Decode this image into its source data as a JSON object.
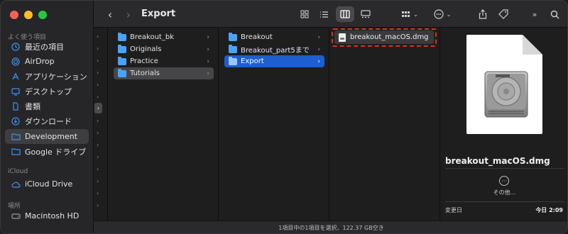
{
  "window": {
    "title": "Export"
  },
  "colors": {
    "close": "#fe5f57",
    "minimize": "#febc2e",
    "zoom": "#28c840",
    "accent": "#1b5fd1",
    "folder": "#4aa3f5",
    "highlight_box": "#d9321f"
  },
  "sidebar": {
    "favorites_title": "よく使う項目",
    "favorites": [
      {
        "label": "最近の項目",
        "icon": "clock-icon"
      },
      {
        "label": "AirDrop",
        "icon": "airdrop-icon"
      },
      {
        "label": "アプリケーション",
        "icon": "applications-icon"
      },
      {
        "label": "デスクトップ",
        "icon": "desktop-icon"
      },
      {
        "label": "書類",
        "icon": "document-icon"
      },
      {
        "label": "ダウンロード",
        "icon": "download-icon"
      },
      {
        "label": "Development",
        "icon": "folder-icon",
        "selected": true
      },
      {
        "label": "Google ドライブ",
        "icon": "folder-icon"
      }
    ],
    "icloud_title": "iCloud",
    "icloud": [
      {
        "label": "iCloud Drive",
        "icon": "cloud-icon"
      }
    ],
    "locations_title": "場所",
    "locations": [
      {
        "label": "Macintosh HD",
        "icon": "disk-icon"
      }
    ]
  },
  "columns": {
    "col1": [
      {
        "label": "Breakout_bk"
      },
      {
        "label": "Originals"
      },
      {
        "label": "Practice"
      },
      {
        "label": "Tutorials",
        "selected": true
      }
    ],
    "col2": [
      {
        "label": "Breakout"
      },
      {
        "label": "Breakout_part5まで"
      },
      {
        "label": "Export",
        "selected": true
      }
    ],
    "col3": [
      {
        "label": "breakout_macOS.dmg",
        "selected": true
      }
    ]
  },
  "preview": {
    "filename": "breakout_macOS.dmg",
    "more_label": "その他...",
    "modified_label": "変更日",
    "modified_value": "今日 2:09"
  },
  "status": {
    "text": "1項目中の1項目を選択、122.37 GB空き"
  }
}
